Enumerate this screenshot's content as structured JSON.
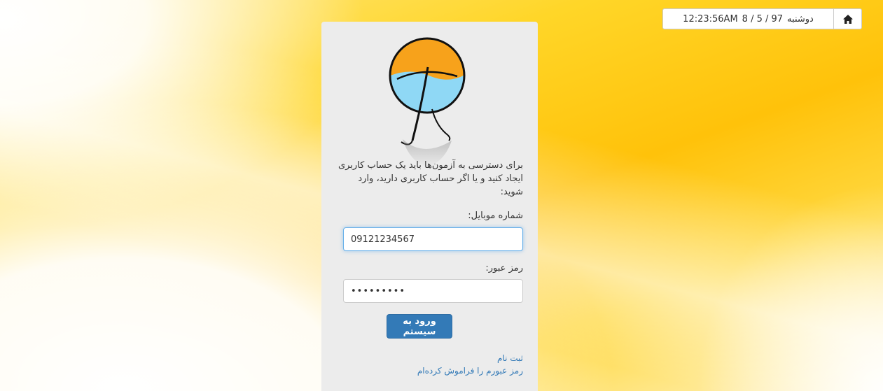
{
  "header": {
    "weekday": "دوشنبه",
    "date": "8 / 5 / 97",
    "time": "12:23:56AM",
    "home_icon": "home-icon"
  },
  "login": {
    "intro": "برای دسترسی به آزمون‌ها باید یک حساب کاربری ایجاد کنید و یا اگر حساب کاربری دارید، وارد شوید:",
    "mobile_label": "شماره موبایل:",
    "mobile_value": "09121234567",
    "password_label": "رمز عبور:",
    "password_value": "•••••••••",
    "submit_label": "ورود به سیستم",
    "register_link": "ثبت نام",
    "forgot_link": "رمز عبورم را فراموش کرده‌ام"
  },
  "colors": {
    "primary": "#337ab7",
    "panel_bg": "#ececec",
    "logo_orange": "#f7a21b",
    "logo_blue": "#8fd8f5"
  }
}
